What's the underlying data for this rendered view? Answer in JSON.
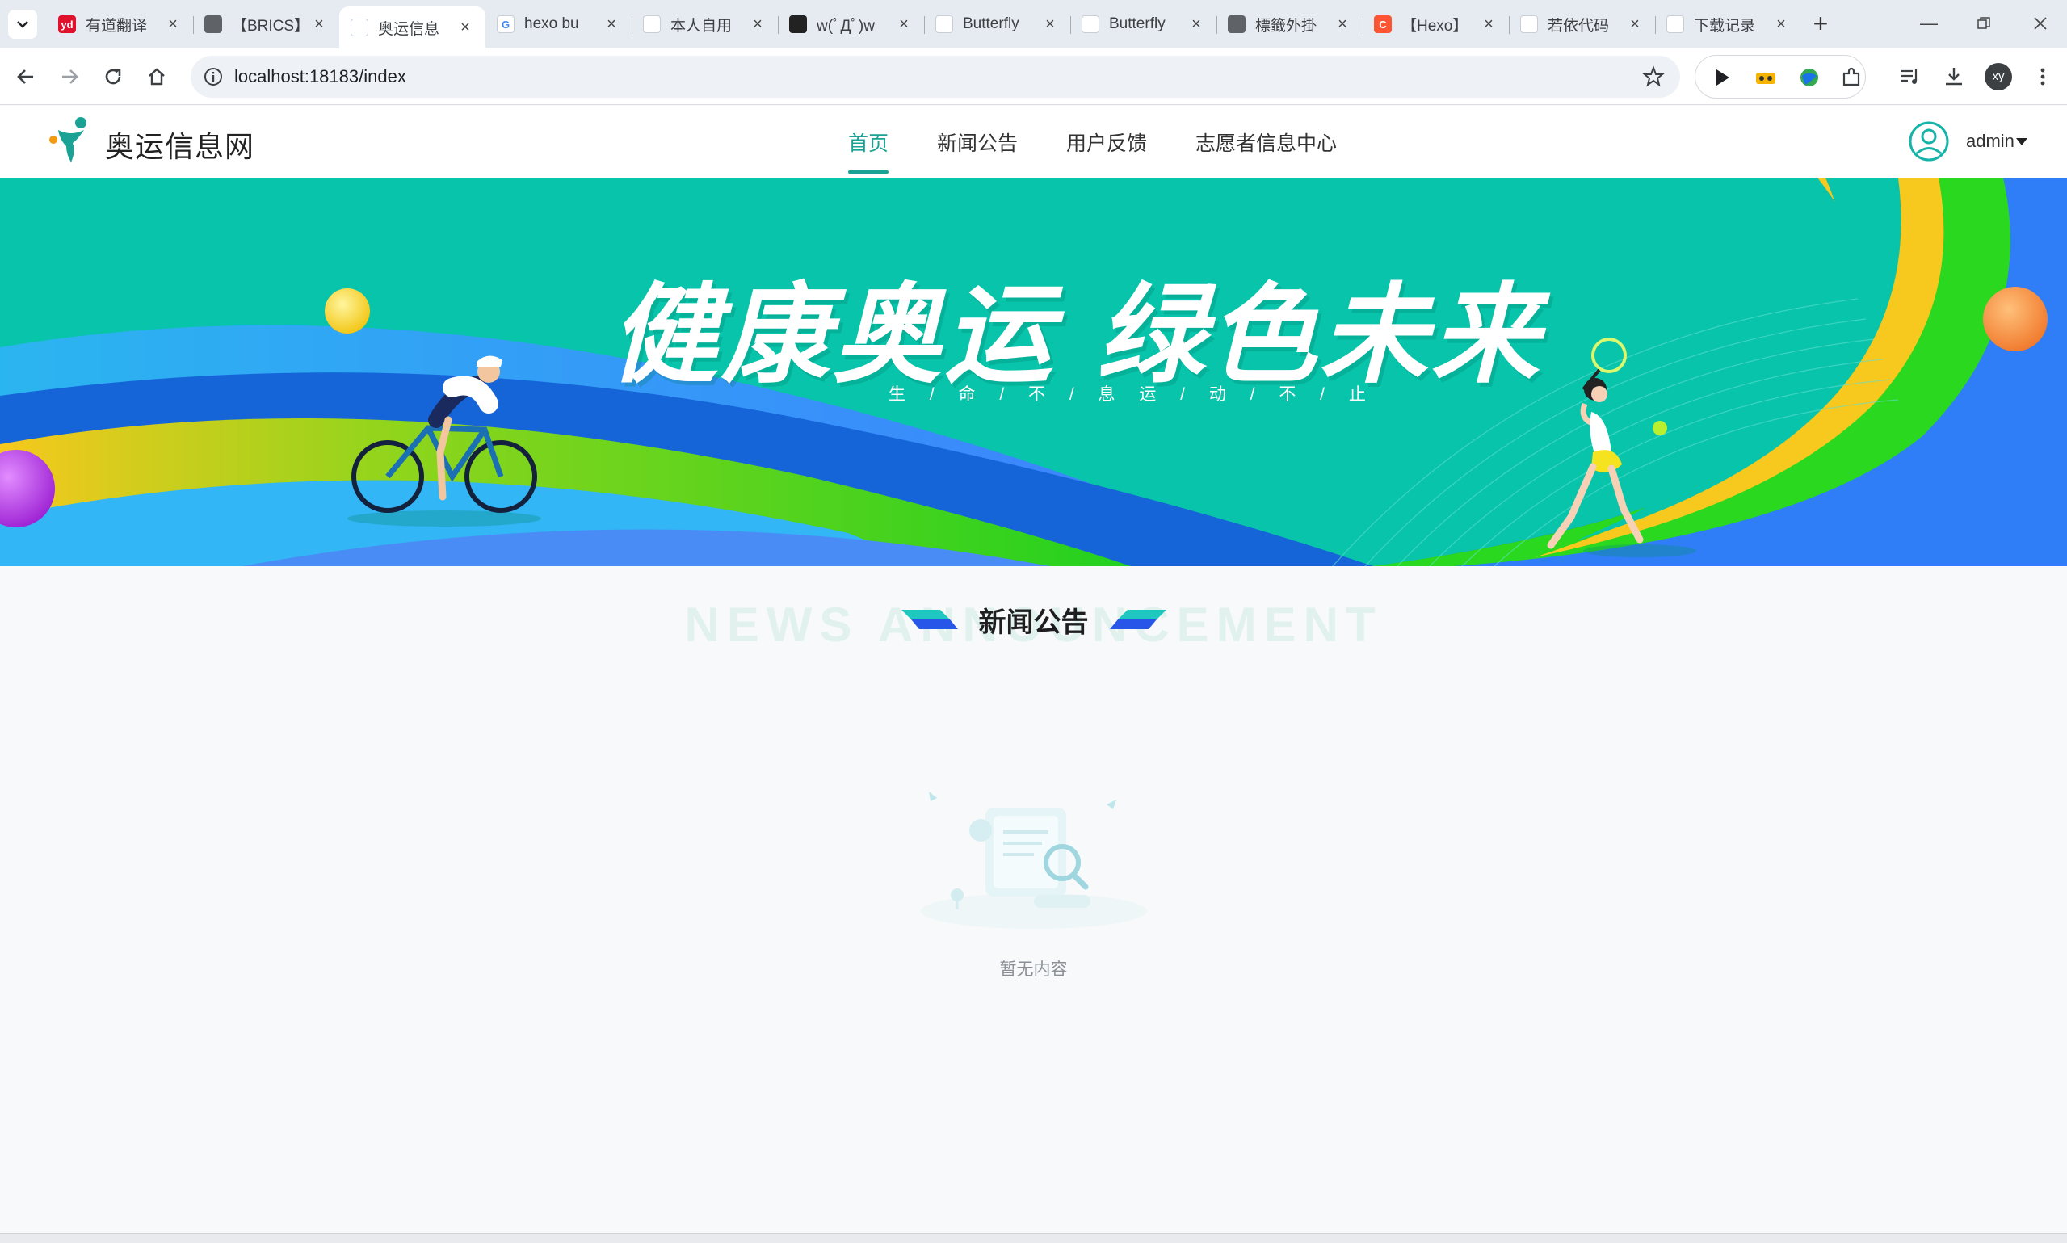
{
  "browser": {
    "tabs": [
      {
        "title": "有道翻译",
        "favicon": "youdao-icon",
        "fav_color": "#e0112b",
        "fav_text": "yd",
        "active": false
      },
      {
        "title": "【BRICS】",
        "favicon": "globe-icon",
        "fav_color": "#5f6368",
        "fav_text": "",
        "active": false
      },
      {
        "title": "奥运信息",
        "favicon": "site-logo-icon",
        "fav_color": "#ffffff",
        "fav_text": "",
        "active": true
      },
      {
        "title": "hexo bu",
        "favicon": "google-icon",
        "fav_color": "#ffffff",
        "fav_text": "G",
        "active": false
      },
      {
        "title": "本人自用",
        "favicon": "person-icon",
        "fav_color": "#ffffff",
        "fav_text": "",
        "active": false
      },
      {
        "title": "w(ﾟДﾟ)w",
        "favicon": "dark-app-icon",
        "fav_color": "#222222",
        "fav_text": "",
        "active": false
      },
      {
        "title": "Butterfly",
        "favicon": "butterfly-icon",
        "fav_color": "#ffffff",
        "fav_text": "",
        "active": false
      },
      {
        "title": "Butterfly",
        "favicon": "butterfly-icon",
        "fav_color": "#ffffff",
        "fav_text": "",
        "active": false
      },
      {
        "title": "標籤外掛",
        "favicon": "globe-icon",
        "fav_color": "#5f6368",
        "fav_text": "",
        "active": false
      },
      {
        "title": "【Hexo】",
        "favicon": "csdn-icon",
        "fav_color": "#fc5531",
        "fav_text": "C",
        "active": false
      },
      {
        "title": "若依代码",
        "favicon": "ruoyi-icon",
        "fav_color": "#ffffff",
        "fav_text": "",
        "active": false
      },
      {
        "title": "下载记录",
        "favicon": "download-icon",
        "fav_color": "#ffffff",
        "fav_text": "",
        "active": false
      }
    ],
    "url": "localhost:18183/index",
    "profile_initials": "xy"
  },
  "site": {
    "name": "奥运信息网",
    "menu": [
      {
        "label": "首页",
        "active": true
      },
      {
        "label": "新闻公告",
        "active": false
      },
      {
        "label": "用户反馈",
        "active": false
      },
      {
        "label": "志愿者信息中心",
        "active": false
      }
    ],
    "user": "admin"
  },
  "banner": {
    "title": "健康奥运  绿色未来",
    "subtitle": "生 / 命 / 不 / 息   运 / 动 / 不 / 止"
  },
  "news": {
    "section_title": "新闻公告",
    "section_title_en": "NEWS ANNOUNCEMENT",
    "empty_text": "暂无内容"
  },
  "colors": {
    "accent": "#1aa394",
    "banner_bg": "#08c4ab"
  }
}
